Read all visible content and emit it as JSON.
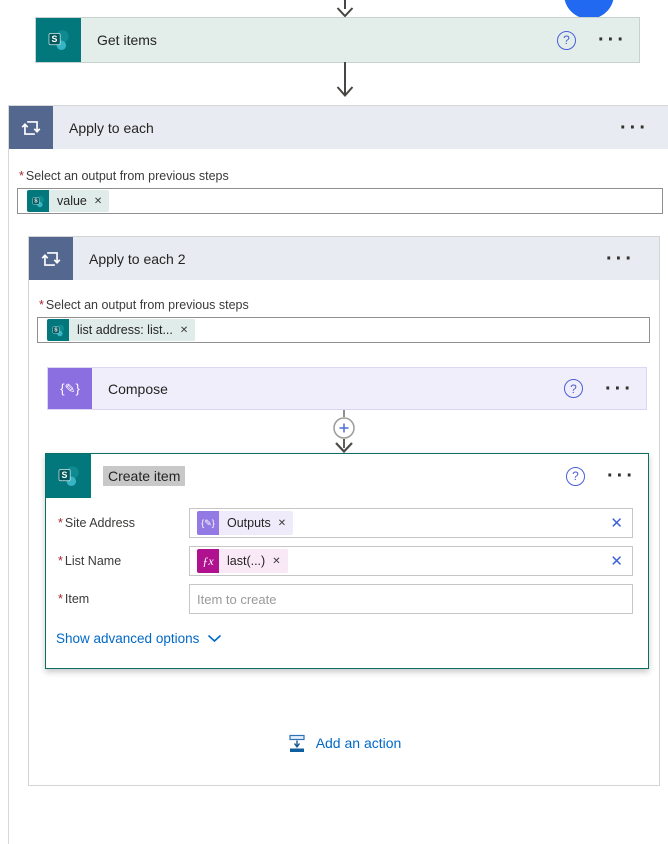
{
  "icons": {
    "help": "?",
    "ellipsis": "···",
    "close": "✕",
    "chip_remove": "✕",
    "compose_glyph": "{✎}",
    "fx_glyph": "ƒx",
    "required": "*"
  },
  "get_items": {
    "title": "Get items"
  },
  "apply_to_each": {
    "title": "Apply to each",
    "field_label": "Select an output from previous steps",
    "token": "value"
  },
  "apply_to_each_2": {
    "title": "Apply to each 2",
    "field_label": "Select an output from previous steps",
    "token": "list address: list..."
  },
  "compose": {
    "title": "Compose"
  },
  "create_item": {
    "title": "Create item",
    "fields": [
      {
        "label": "Site Address",
        "token": "Outputs"
      },
      {
        "label": "List Name",
        "token": "last(...)"
      },
      {
        "label": "Item",
        "placeholder": "Item to create"
      }
    ],
    "advanced": "Show advanced options"
  },
  "add_action": {
    "label": "Add an action"
  },
  "colors": {
    "sharepoint_teal": "#03787c",
    "loop_blue": "#54678e",
    "compose_purple": "#8b6edf",
    "fx_magenta": "#b0128f",
    "selected_border": "#0c6f63",
    "link_blue": "#0069c7",
    "accent_circle": "#2069f0"
  }
}
